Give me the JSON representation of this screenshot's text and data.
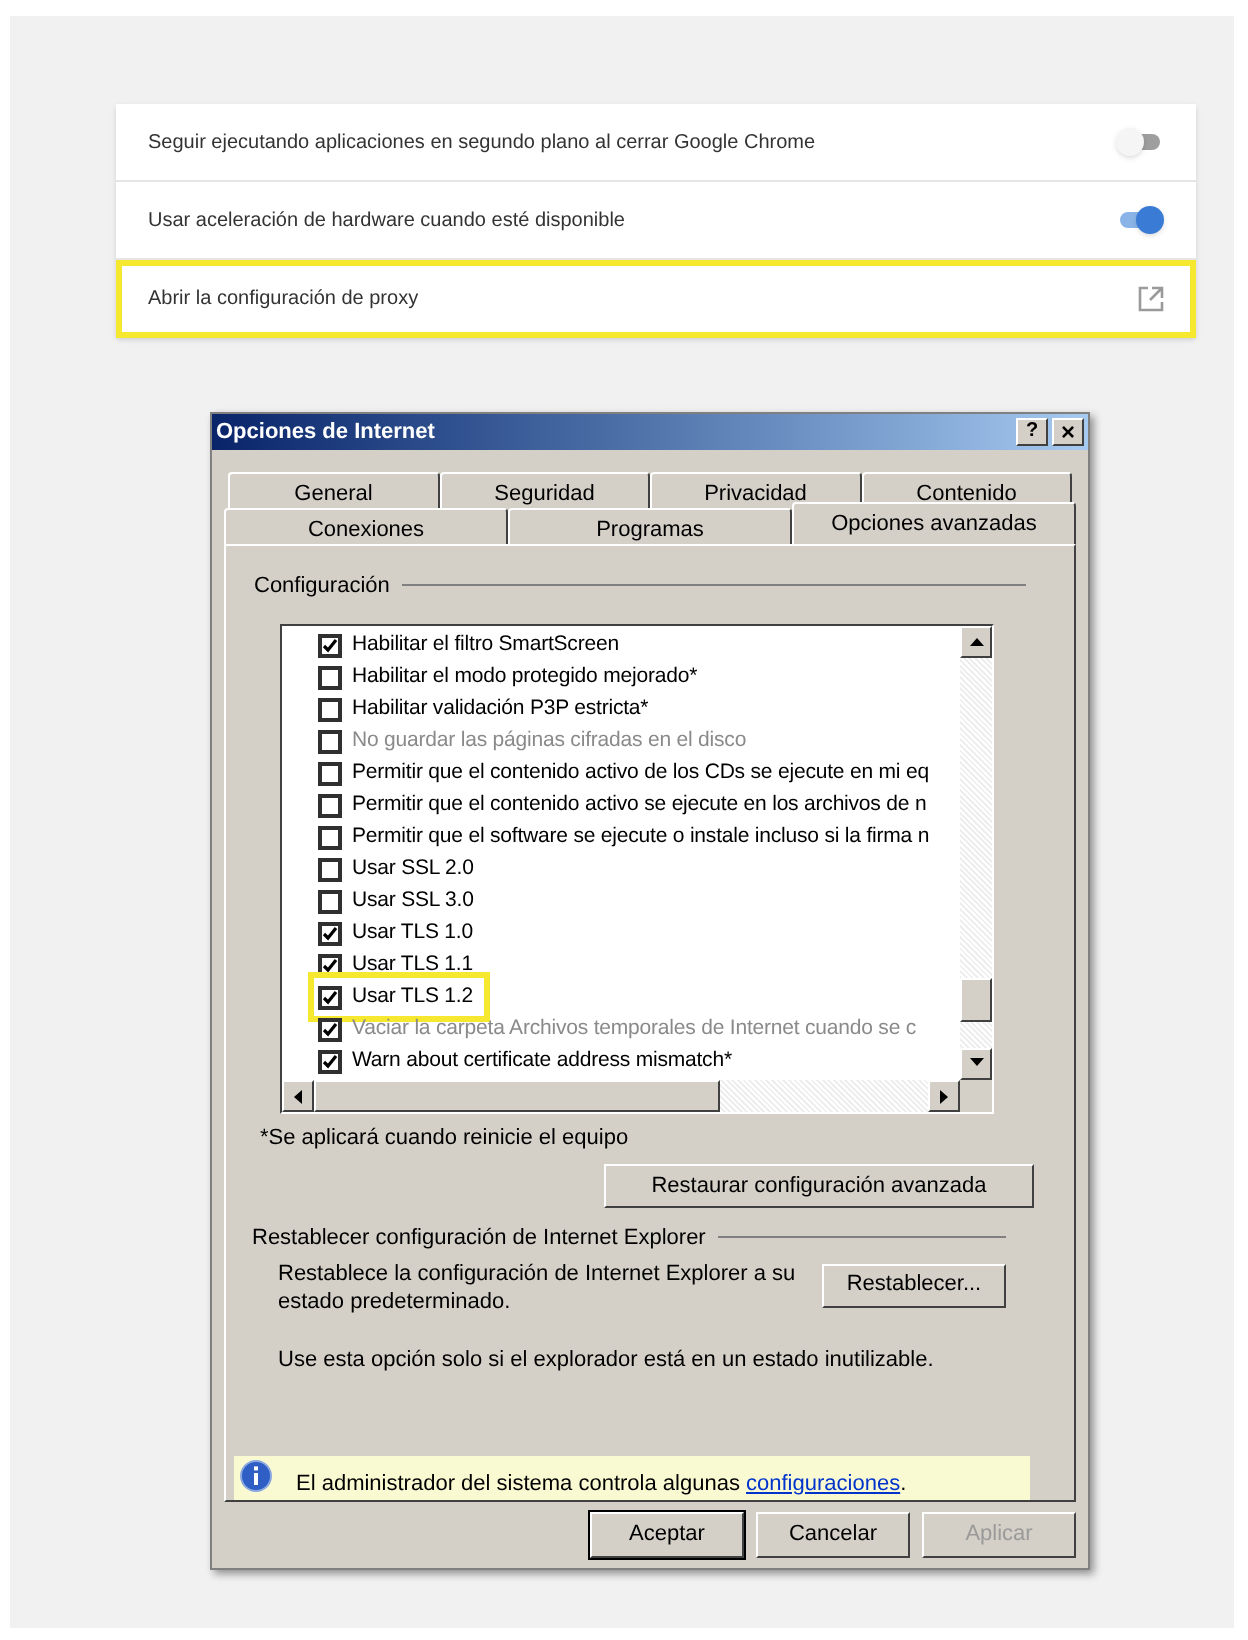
{
  "settings": [
    {
      "kind": "toggle",
      "label": "Seguir ejecutando aplicaciones en segundo plano al cerrar Google Chrome",
      "on": false,
      "highlighted": false
    },
    {
      "kind": "toggle",
      "label": "Usar aceleración de hardware cuando esté disponible",
      "on": true,
      "highlighted": false
    },
    {
      "kind": "link",
      "label": "Abrir la configuración de proxy",
      "highlighted": true
    }
  ],
  "dialog": {
    "title": "Opciones de Internet",
    "help": "?",
    "close": "×",
    "tab_rows": [
      [
        {
          "label": "General",
          "selected": false
        },
        {
          "label": "Seguridad",
          "selected": false
        },
        {
          "label": "Privacidad",
          "selected": false
        },
        {
          "label": "Contenido",
          "selected": false
        }
      ],
      [
        {
          "label": "Conexiones",
          "selected": false
        },
        {
          "label": "Programas",
          "selected": false
        },
        {
          "label": "Opciones avanzadas",
          "selected": true
        }
      ]
    ],
    "group_title": "Configuración",
    "options": [
      {
        "label": "Habilitar el filtro SmartScreen",
        "checked": true,
        "disabled": false,
        "highlighted": false
      },
      {
        "label": "Habilitar el modo protegido mejorado*",
        "checked": false,
        "disabled": false,
        "highlighted": false
      },
      {
        "label": "Habilitar validación P3P estricta*",
        "checked": false,
        "disabled": false,
        "highlighted": false
      },
      {
        "label": "No guardar las páginas cifradas en el disco",
        "checked": false,
        "disabled": true,
        "highlighted": false
      },
      {
        "label": "Permitir que el contenido activo de los CDs se ejecute en mi eq",
        "checked": false,
        "disabled": false,
        "highlighted": false
      },
      {
        "label": "Permitir que el contenido activo se ejecute en los archivos de n",
        "checked": false,
        "disabled": false,
        "highlighted": false
      },
      {
        "label": "Permitir que el software se ejecute o instale incluso si la firma n",
        "checked": false,
        "disabled": false,
        "highlighted": false
      },
      {
        "label": "Usar SSL 2.0",
        "checked": false,
        "disabled": false,
        "highlighted": false
      },
      {
        "label": "Usar SSL 3.0",
        "checked": false,
        "disabled": false,
        "highlighted": false
      },
      {
        "label": "Usar TLS 1.0",
        "checked": true,
        "disabled": false,
        "highlighted": false
      },
      {
        "label": "Usar TLS 1.1",
        "checked": true,
        "disabled": false,
        "highlighted": false
      },
      {
        "label": "Usar TLS 1.2",
        "checked": true,
        "disabled": false,
        "highlighted": true
      },
      {
        "label": "Vaciar la carpeta Archivos temporales de Internet cuando se c",
        "checked": true,
        "disabled": true,
        "highlighted": false
      },
      {
        "label": "Warn about certificate address mismatch*",
        "checked": true,
        "disabled": false,
        "highlighted": false
      }
    ],
    "restart_note": "*Se aplicará cuando reinicie el equipo",
    "restore_button": "Restaurar configuración avanzada",
    "reset_group_title": "Restablecer configuración de Internet Explorer",
    "reset_text": "Restablece la configuración de Internet Explorer a su estado predeterminado.",
    "reset_button": "Restablecer...",
    "reset_warning": "Use esta opción solo si el explorador está en un estado inutilizable.",
    "info_text": "El administrador del sistema controla algunas",
    "info_link": "configuraciones",
    "info_end": ".",
    "buttons": [
      {
        "label": "Aceptar",
        "disabled": false
      },
      {
        "label": "Cancelar",
        "disabled": false
      },
      {
        "label": "Aplicar",
        "disabled": true
      }
    ]
  }
}
